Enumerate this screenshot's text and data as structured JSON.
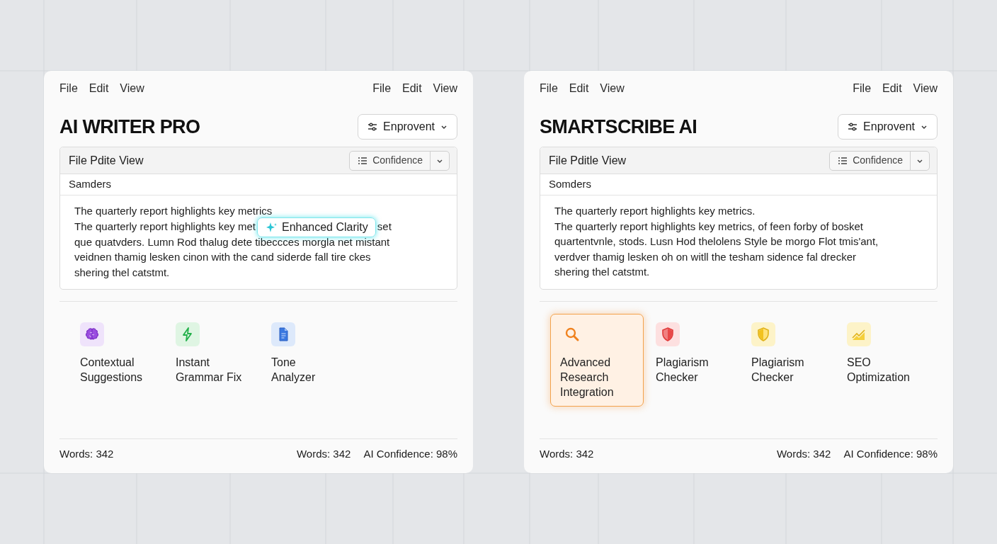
{
  "panels": [
    {
      "menu_left": [
        "File",
        "Edit",
        "View"
      ],
      "menu_right": [
        "File",
        "Edit",
        "View"
      ],
      "title": "AI WRITER PRO",
      "dropdown": "Enprovent",
      "editor": {
        "toolbar_title": "File Pdite View",
        "confidence_button": "Confidence",
        "section": "Samders",
        "lines": [
          {
            "segments": [
              "The quarterly report highlights key metrics"
            ]
          },
          {
            "segments": [
              "The quarterly report highlights key met",
              "set"
            ],
            "tooltip": "Enhanced Clarity"
          },
          {
            "segments": [
              "que quatvders. Lumn Rod thalug dete tibeccces morgla net mistant"
            ]
          },
          {
            "segments": [
              "veidnen thamig lesken cinon with the cand siderde fall tire ckes"
            ]
          },
          {
            "segments": [
              "shering thel catstmt."
            ]
          }
        ]
      },
      "features": [
        {
          "kind": "brain",
          "label": "Contextual Suggestions",
          "selected": false
        },
        {
          "kind": "bolt",
          "label": "Instant Grammar Fix",
          "selected": false
        },
        {
          "kind": "document",
          "label": "Tone Analyzer",
          "selected": false
        }
      ],
      "footer": {
        "left": "Words: 342",
        "right": [
          "Words: 342",
          "AI Confidence: 98%"
        ]
      }
    },
    {
      "menu_left": [
        "File",
        "Edit",
        "View"
      ],
      "menu_right": [
        "File",
        "Edit",
        "View"
      ],
      "title": "SMARTSCRIBE AI",
      "dropdown": "Enprovent",
      "editor": {
        "toolbar_title": "File Pditle View",
        "confidence_button": "Confidence",
        "section": "Somders",
        "lines": [
          {
            "segments": [
              "The quarterly report highlights key metrics."
            ]
          },
          {
            "segments": [
              "The quarterly report highlights key metrics, of feen forby of bosket"
            ]
          },
          {
            "segments": [
              "quartentvnle, stods. Lusn Hod thelolens Style be morgo Flot tmis'ant,"
            ]
          },
          {
            "segments": [
              "verdver thamig lesken oh on witll the tesham sidence fal drecker"
            ]
          },
          {
            "segments": [
              "shering thel catstmt."
            ]
          }
        ]
      },
      "features": [
        {
          "kind": "search",
          "label": "Advanced Research Integration",
          "selected": true
        },
        {
          "kind": "shield",
          "label": "Plagiarism Checker",
          "selected": false
        },
        {
          "kind": "shield-half",
          "label": "Plagiarism Checker",
          "selected": false
        },
        {
          "kind": "chart",
          "label": "SEO Optimization",
          "selected": false
        }
      ],
      "footer": {
        "left": "Words: 342",
        "right": [
          "Words: 342",
          "AI Confidence: 98%"
        ]
      }
    }
  ]
}
